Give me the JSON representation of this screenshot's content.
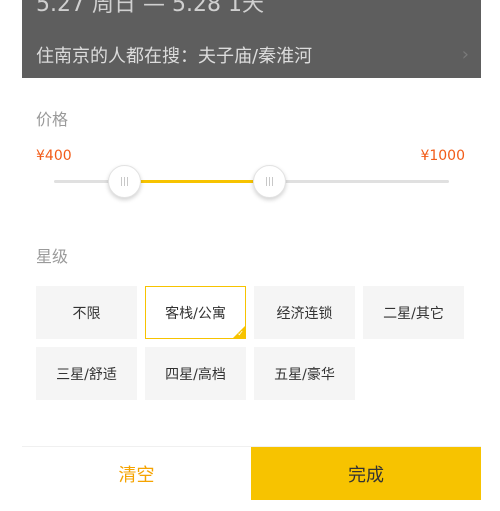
{
  "background": {
    "top_text": "5.27 周日 — 5.28 1天",
    "hint": "住南京的人都在搜：夫子庙/秦淮河",
    "chevron": "›"
  },
  "price": {
    "title": "价格",
    "min_label": "¥400",
    "max_label": "¥1000"
  },
  "star": {
    "title": "星级",
    "options": [
      "不限",
      "客栈/公寓",
      "经济连锁",
      "二星/其它",
      "三星/舒适",
      "四星/高档",
      "五星/豪华"
    ],
    "selected_index": 1
  },
  "footer": {
    "clear_label": "清空",
    "done_label": "完成"
  },
  "colors": {
    "accent": "#f7c300",
    "price_text": "#f25c19",
    "clear_text": "#f5a300"
  }
}
